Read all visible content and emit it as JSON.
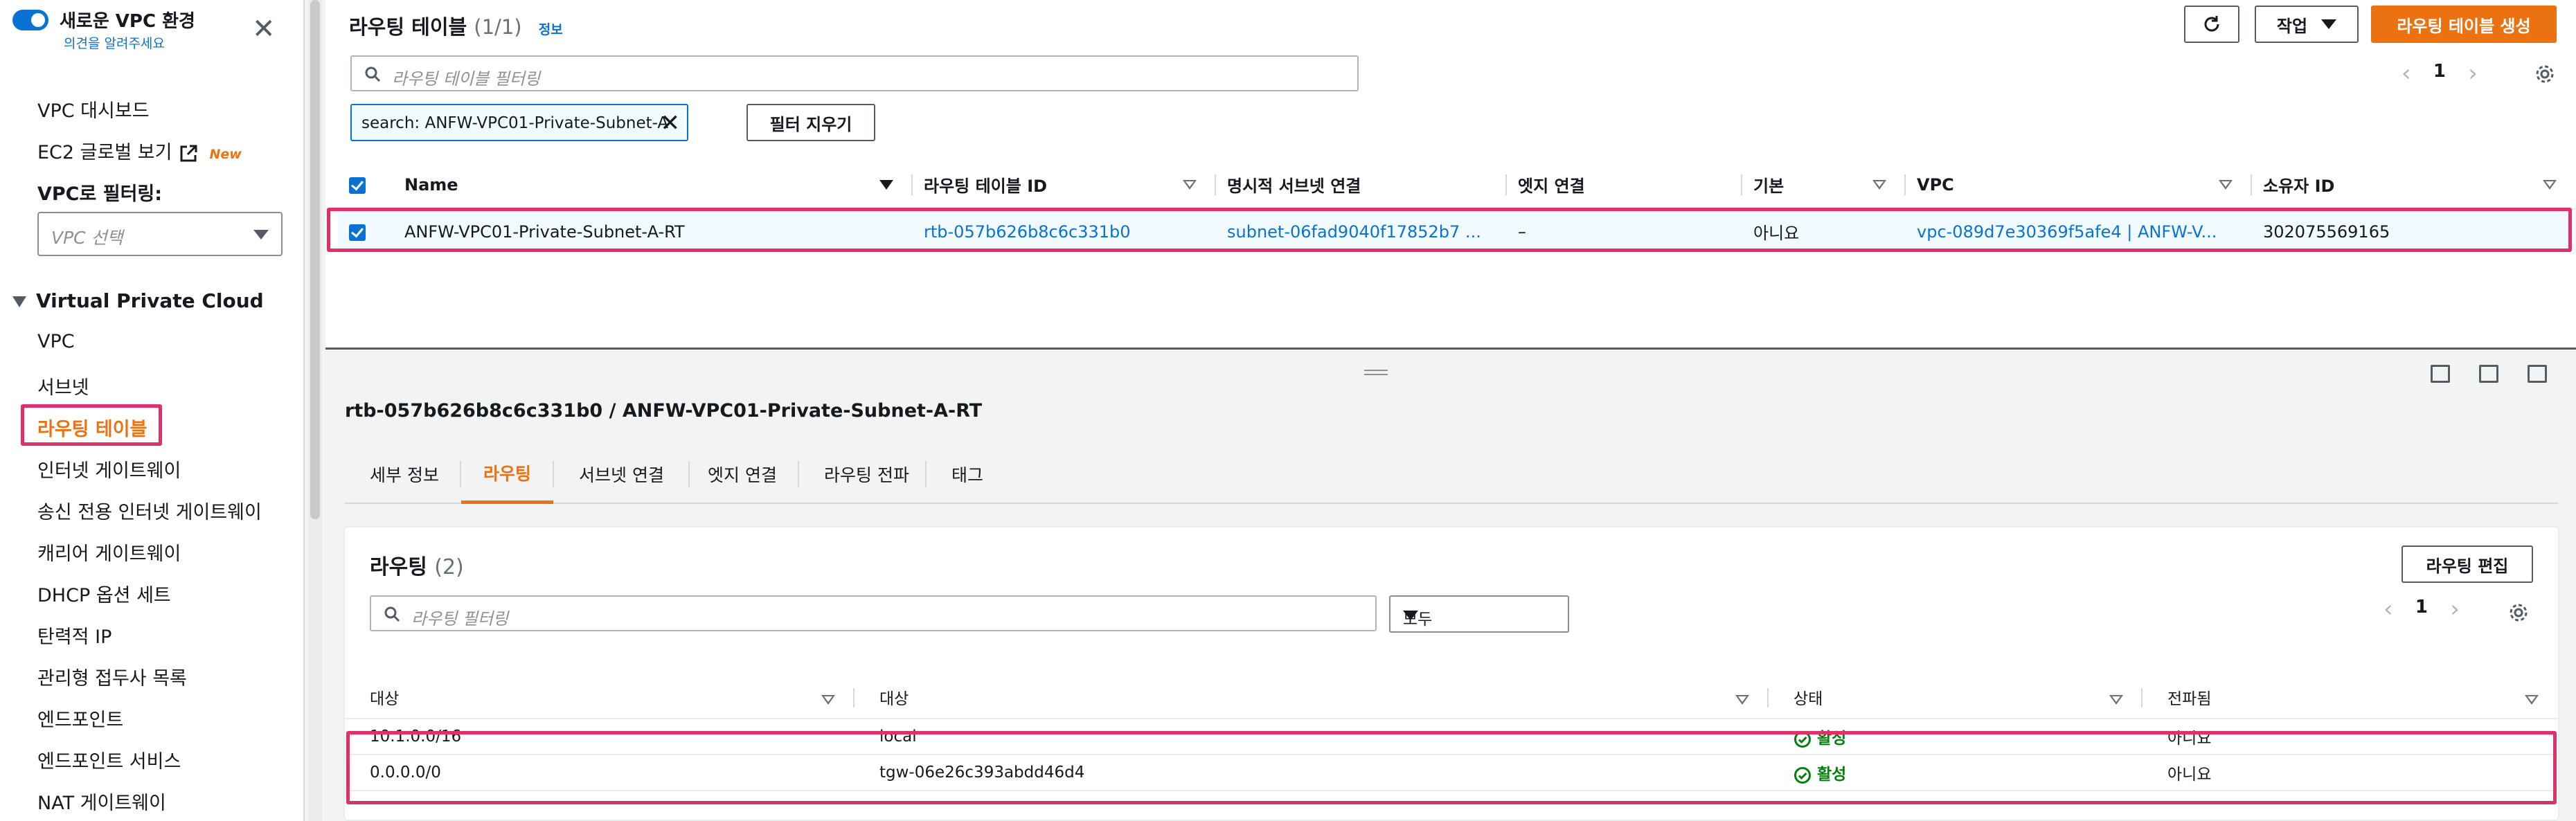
{
  "sidebar": {
    "header_title": "새로운 VPC 환경",
    "feedback_link": "의견을 알려주세요",
    "items_top": [
      "VPC 대시보드",
      "EC2 글로벌 보기"
    ],
    "new_badge": "New",
    "filter_label": "VPC로 필터링:",
    "vpc_select_placeholder": "VPC 선택",
    "section_title": "Virtual Private Cloud",
    "items": [
      "VPC",
      "서브넷",
      "라우팅 테이블",
      "인터넷 게이트웨이",
      "송신 전용 인터넷 게이트웨이",
      "캐리어 게이트웨이",
      "DHCP 옵션 세트",
      "탄력적 IP",
      "관리형 접두사 목록",
      "엔드포인트",
      "엔드포인트 서비스",
      "NAT 게이트웨이"
    ]
  },
  "route_tables": {
    "title": "라우팅 테이블",
    "count": "(1/1)",
    "info": "정보",
    "actions_label": "작업",
    "create_label": "라우팅 테이블 생성",
    "search_placeholder": "라우팅 테이블 필터링",
    "filter_token": "search: ANFW-VPC01-Private-Subnet-A",
    "clear_filters_label": "필터 지우기",
    "page": "1",
    "columns": [
      "Name",
      "라우팅 테이블 ID",
      "명시적 서브넷 연결",
      "엣지 연결",
      "기본",
      "VPC",
      "소유자 ID"
    ],
    "rows": [
      {
        "name": "ANFW-VPC01-Private-Subnet-A-RT",
        "id": "rtb-057b626b8c6c331b0",
        "subnet": "subnet-06fad9040f17852b7 ...",
        "edge": "–",
        "main": "아니요",
        "vpc": "vpc-089d7e30369f5afe4 | ANFW-V...",
        "owner": "302075569165"
      }
    ]
  },
  "detail": {
    "title": "rtb-057b626b8c6c331b0 / ANFW-VPC01-Private-Subnet-A-RT",
    "tabs": [
      "세부 정보",
      "라우팅",
      "서브넷 연결",
      "엣지 연결",
      "라우팅 전파",
      "태그"
    ],
    "active_tab": "라우팅",
    "routes": {
      "title": "라우팅",
      "count": "(2)",
      "edit_label": "라우팅 편집",
      "search_placeholder": "라우팅 필터링",
      "select_value": "모두",
      "page": "1",
      "columns": [
        "대상",
        "대상",
        "상태",
        "전파됨"
      ],
      "rows": [
        {
          "destination": "10.1.0.0/16",
          "target": "local",
          "status": "활성",
          "propagated": "아니요"
        },
        {
          "destination": "0.0.0.0/0",
          "target": "tgw-06e26c393abdd46d4",
          "status": "활성",
          "propagated": "아니요"
        }
      ]
    }
  },
  "colors": {
    "accent": "#ec7211",
    "link": "#0972d3",
    "highlight": "#e0306a",
    "success": "#037f0c"
  }
}
